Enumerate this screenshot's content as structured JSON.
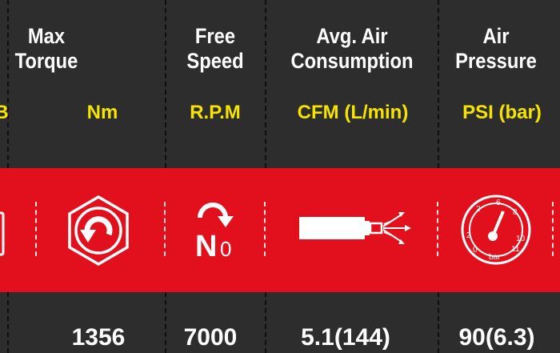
{
  "columns": [
    {
      "id": "partial",
      "unit": "B",
      "icon": "partial-icon"
    },
    {
      "id": "max-torque",
      "header": "Max\nTorque",
      "unit": "Nm",
      "icon": "torque-nut-icon",
      "value": "1356"
    },
    {
      "id": "free-speed",
      "header": "Free\nSpeed",
      "unit": "R.P.M",
      "icon": "free-speed-icon",
      "icon_text": "N",
      "icon_sub": "0",
      "value": "7000"
    },
    {
      "id": "air-consumption",
      "header": "Avg. Air\nConsumption",
      "unit": "CFM (L/min)",
      "icon": "air-hose-icon",
      "value": "5.1(144)"
    },
    {
      "id": "air-pressure",
      "header": "Air\nPressure",
      "unit": "PSI (bar)",
      "icon": "pressure-gauge-icon",
      "gauge_labels": [
        "0",
        "2",
        "2",
        "6",
        "8",
        "10",
        "11",
        "bar"
      ],
      "value": "90(6.3)"
    }
  ],
  "colors": {
    "background": "#2d2d2d",
    "band": "#e2101c",
    "unit_text": "#f5e400",
    "header_text": "#ffffff"
  }
}
